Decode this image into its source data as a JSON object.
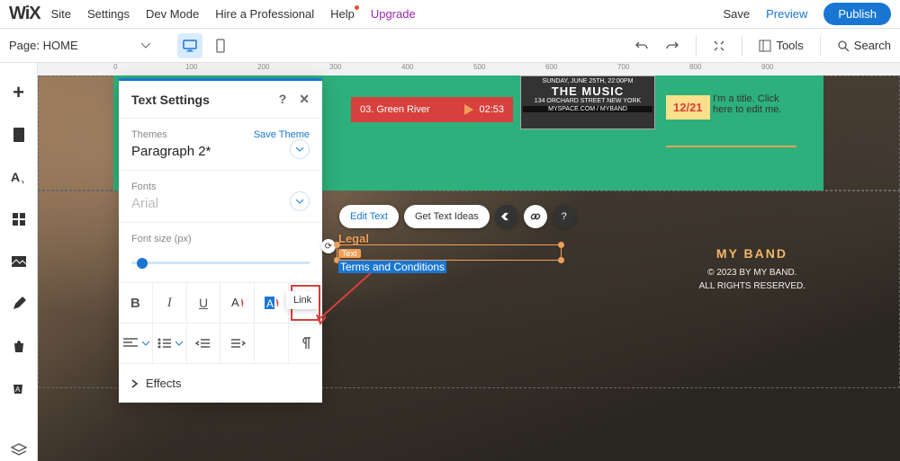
{
  "top": {
    "logo": "WiX",
    "menu": [
      "Site",
      "Settings",
      "Dev Mode",
      "Hire a Professional",
      "Help",
      "Upgrade"
    ],
    "save": "Save",
    "preview": "Preview",
    "publish": "Publish"
  },
  "toolbar": {
    "page_prefix": "Page:",
    "page_name": "HOME",
    "tools": "Tools",
    "search": "Search"
  },
  "ruler_marks": [
    "0",
    "100",
    "200",
    "300",
    "400",
    "500",
    "600",
    "700",
    "800",
    "900"
  ],
  "panel": {
    "title": "Text Settings",
    "themes_label": "Themes",
    "save_theme": "Save Theme",
    "theme_value": "Paragraph 2*",
    "fonts_label": "Fonts",
    "font_value": "Arial",
    "fontsize_label": "Font size (px)",
    "row1": {
      "bold": "B",
      "italic": "I",
      "underline": "U",
      "color": "A",
      "highlight": "A",
      "link_tooltip": "Link"
    },
    "effects": "Effects"
  },
  "hero": {
    "track_no": "03.",
    "track_name": "Green River",
    "track_time": "02:53",
    "poster_line1": "SUNDAY, JUNE 25TH, 22:00PM",
    "poster_line2": "THE MUSIC",
    "poster_line3": "134 ORCHARD STREET   NEW YORK",
    "poster_line4": "MYSPACE.COM / MYBAND",
    "date_badge": "12/21",
    "title_hint": "I'm a title. Click here to edit me."
  },
  "chips": {
    "edit": "Edit Text",
    "ideas": "Get Text Ideas"
  },
  "selected_text": {
    "heading": "Legal",
    "tag": "Text",
    "highlighted": "Terms and Conditions"
  },
  "footer": {
    "brand": "MY BAND",
    "line1": "© 2023 BY MY BAND.",
    "line2": "ALL RIGHTS RESERVED."
  }
}
